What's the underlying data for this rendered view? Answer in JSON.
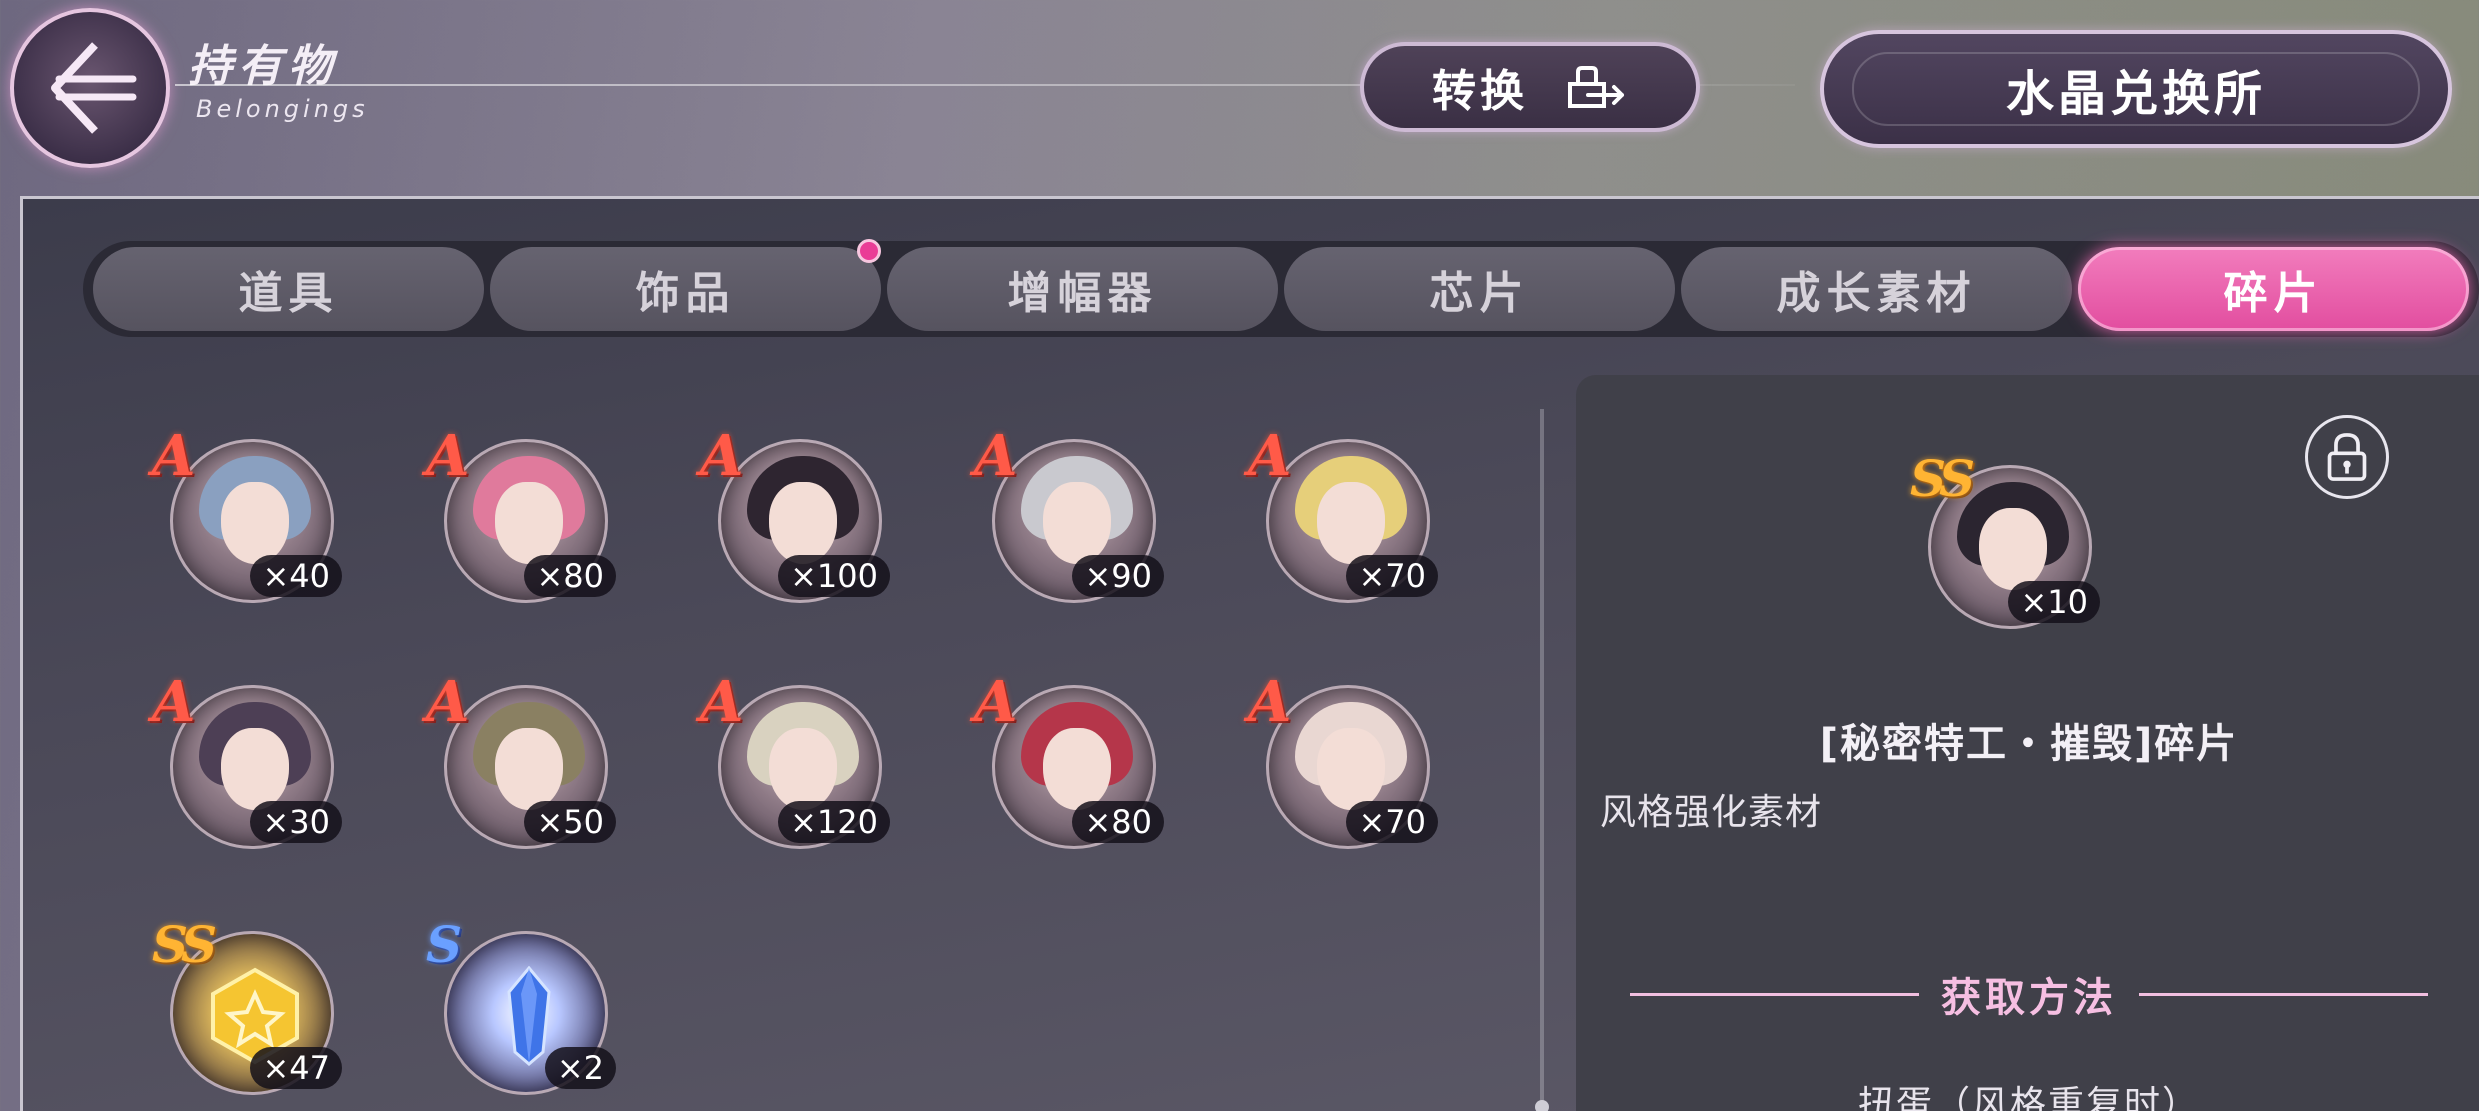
{
  "header": {
    "title_cn": "持有物",
    "title_en": "Belongings",
    "convert_label": "转换",
    "crystal_shop_label": "水晶兑换所"
  },
  "tabs": [
    {
      "label": "道具",
      "active": false,
      "notification": false
    },
    {
      "label": "饰品",
      "active": false,
      "notification": true
    },
    {
      "label": "增幅器",
      "active": false,
      "notification": false
    },
    {
      "label": "芯片",
      "active": false,
      "notification": false
    },
    {
      "label": "成长素材",
      "active": false,
      "notification": false
    },
    {
      "label": "碎片",
      "active": true,
      "notification": false
    }
  ],
  "items": [
    {
      "rarity": "A",
      "count": "×40",
      "icon": "character-portrait-icon",
      "hair": "#8aa0c0"
    },
    {
      "rarity": "A",
      "count": "×80",
      "icon": "character-portrait-icon",
      "hair": "#e07a9c"
    },
    {
      "rarity": "A",
      "count": "×100",
      "icon": "character-portrait-icon",
      "hair": "#2e2530"
    },
    {
      "rarity": "A",
      "count": "×90",
      "icon": "character-portrait-icon",
      "hair": "#c9c9cf"
    },
    {
      "rarity": "A",
      "count": "×70",
      "icon": "character-portrait-icon",
      "hair": "#e6cf7a"
    },
    {
      "rarity": "A",
      "count": "×30",
      "icon": "character-portrait-icon",
      "hair": "#4d3f55"
    },
    {
      "rarity": "A",
      "count": "×50",
      "icon": "character-portrait-icon",
      "hair": "#8a8062"
    },
    {
      "rarity": "A",
      "count": "×120",
      "icon": "character-portrait-icon",
      "hair": "#d9d2c0"
    },
    {
      "rarity": "A",
      "count": "×80",
      "icon": "character-portrait-icon",
      "hair": "#b5364a"
    },
    {
      "rarity": "A",
      "count": "×70",
      "icon": "character-portrait-icon",
      "hair": "#e9d7d2"
    },
    {
      "rarity": "SS",
      "count": "×47",
      "icon": "gold-hexagon-fragment-icon",
      "hair": ""
    },
    {
      "rarity": "S",
      "count": "×2",
      "icon": "blue-crystal-icon",
      "hair": ""
    }
  ],
  "detail": {
    "rarity": "SS",
    "count": "×10",
    "name": "[秘密特工・摧毁]碎片",
    "description": "风格强化素材",
    "obtain_title": "获取方法",
    "obtain_method": "扭蛋（风格重复时）"
  },
  "colors": {
    "accent_pink": "#e24d9f",
    "rarity_a": "#ff5a48",
    "rarity_ss": "#ffb433",
    "rarity_s": "#6aa0ff"
  }
}
